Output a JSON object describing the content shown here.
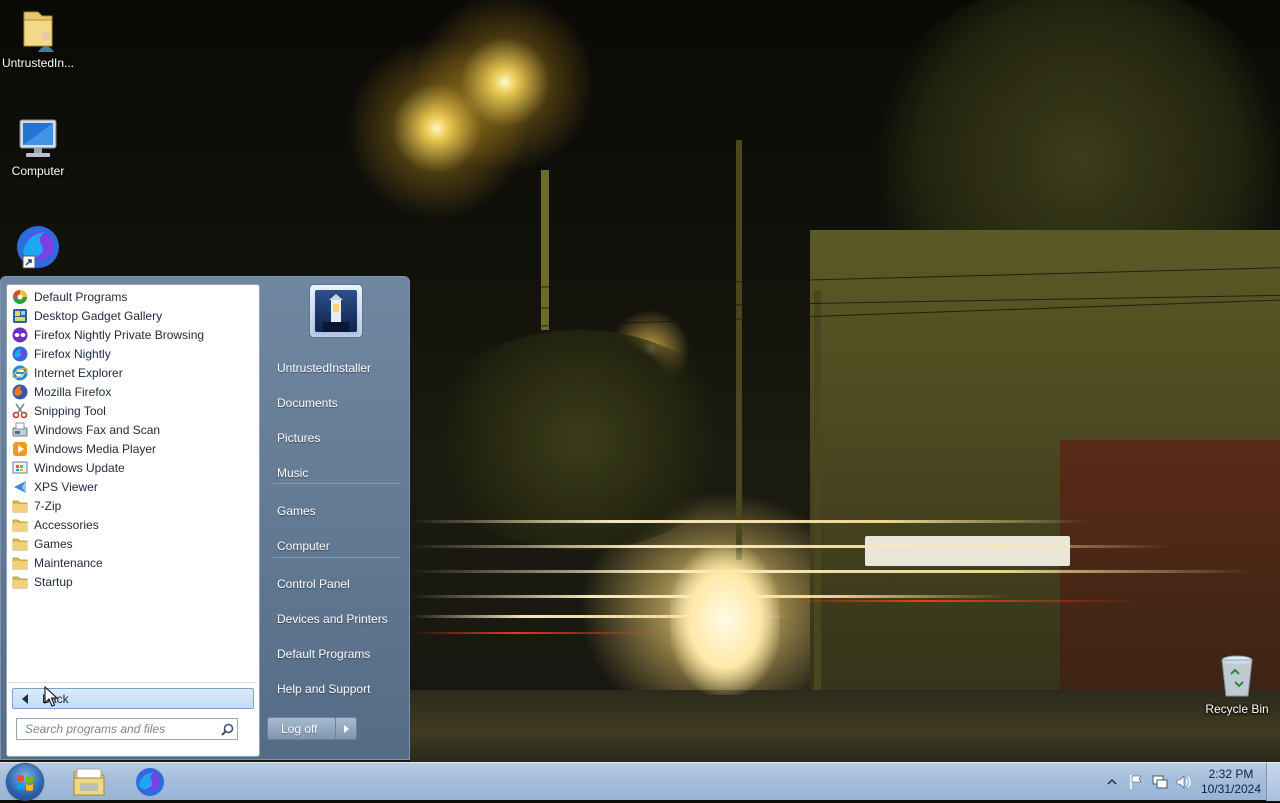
{
  "desktop": {
    "icons": [
      {
        "label": "UntrustedIn...",
        "icon": "user-folder-icon"
      },
      {
        "label": "Computer",
        "icon": "computer-icon"
      },
      {
        "label": "",
        "icon": "firefox-nightly-shortcut-icon"
      },
      {
        "label": "Recycle Bin",
        "icon": "recycle-bin-icon"
      }
    ]
  },
  "start_menu": {
    "programs": [
      {
        "label": "Default Programs",
        "icon": "default-programs-icon"
      },
      {
        "label": "Desktop Gadget Gallery",
        "icon": "gadget-gallery-icon"
      },
      {
        "label": "Firefox Nightly Private Browsing",
        "icon": "private-browsing-icon"
      },
      {
        "label": "Firefox Nightly",
        "icon": "firefox-nightly-icon"
      },
      {
        "label": "Internet Explorer",
        "icon": "internet-explorer-icon"
      },
      {
        "label": "Mozilla Firefox",
        "icon": "firefox-icon"
      },
      {
        "label": "Snipping Tool",
        "icon": "scissors-icon"
      },
      {
        "label": "Windows Fax and Scan",
        "icon": "fax-icon"
      },
      {
        "label": "Windows Media Player",
        "icon": "media-player-icon"
      },
      {
        "label": "Windows Update",
        "icon": "windows-update-icon"
      },
      {
        "label": "XPS Viewer",
        "icon": "xps-viewer-icon"
      },
      {
        "label": "7-Zip",
        "icon": "folder-icon"
      },
      {
        "label": "Accessories",
        "icon": "folder-icon"
      },
      {
        "label": "Games",
        "icon": "folder-icon"
      },
      {
        "label": "Maintenance",
        "icon": "folder-icon"
      },
      {
        "label": "Startup",
        "icon": "folder-icon"
      }
    ],
    "back_label": "Back",
    "search_placeholder": "Search programs and files",
    "right_items": [
      {
        "label": "UntrustedInstaller"
      },
      {
        "label": "Documents"
      },
      {
        "label": "Pictures"
      },
      {
        "label": "Music"
      },
      {
        "label": "Games"
      },
      {
        "label": "Computer"
      },
      {
        "label": "Control Panel"
      },
      {
        "label": "Devices and Printers"
      },
      {
        "label": "Default Programs"
      },
      {
        "label": "Help and Support"
      }
    ],
    "logoff_label": "Log off"
  },
  "taskbar": {
    "pinned": [
      {
        "name": "windows-explorer",
        "icon": "folder-explorer-icon"
      },
      {
        "name": "firefox-nightly",
        "icon": "firefox-nightly-icon"
      }
    ],
    "tray_icons": [
      "show-hidden-icons-icon",
      "action-center-flag-icon",
      "network-icon",
      "volume-icon"
    ],
    "time": "2:32 PM",
    "date": "10/31/2024"
  }
}
